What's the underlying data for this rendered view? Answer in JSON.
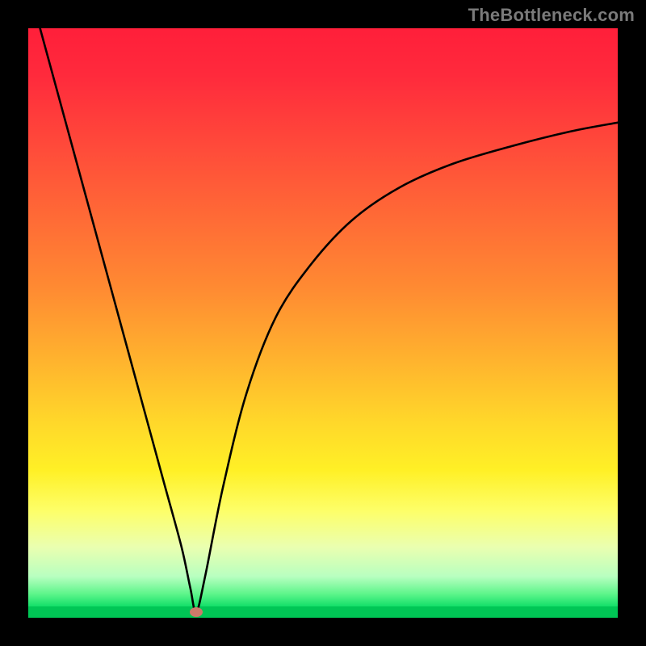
{
  "watermark": "TheBottleneck.com",
  "colors": {
    "frame": "#000000",
    "curve": "#000000",
    "marker": "#cc7a6a",
    "watermark": "#7a7a7a"
  },
  "chart_data": {
    "type": "line",
    "title": "",
    "xlabel": "",
    "ylabel": "",
    "xlim": [
      0,
      100
    ],
    "ylim": [
      0,
      100
    ],
    "grid": false,
    "legend": false,
    "series": [
      {
        "name": "bottleneck-curve",
        "x": [
          2,
          5,
          8,
          11,
          14,
          17,
          20,
          23,
          26,
          27.5,
          28.5,
          30,
          33,
          37,
          42,
          48,
          55,
          63,
          72,
          82,
          92,
          100
        ],
        "y": [
          100,
          89,
          78,
          67,
          56,
          45,
          34,
          23,
          12,
          5,
          1,
          7,
          22,
          38,
          51,
          60,
          67.5,
          73,
          77,
          80,
          82.5,
          84
        ]
      }
    ],
    "marker": {
      "x": 28.5,
      "y": 1
    },
    "gradient_stops": [
      {
        "pos": 0,
        "color": "#ff1f3a"
      },
      {
        "pos": 50,
        "color": "#ffb22e"
      },
      {
        "pos": 80,
        "color": "#fdff6a"
      },
      {
        "pos": 100,
        "color": "#00d65c"
      }
    ]
  }
}
